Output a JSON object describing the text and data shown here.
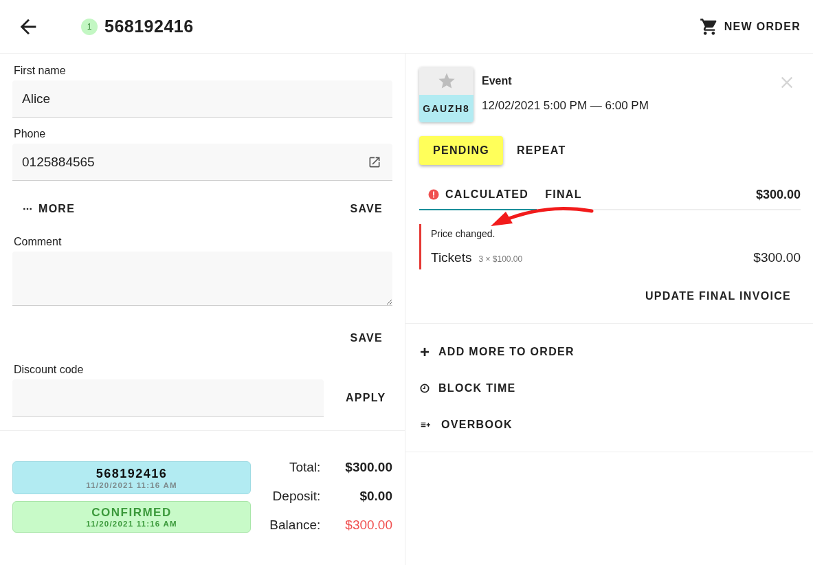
{
  "header": {
    "badge": "1",
    "order_number": "568192416",
    "new_order": "NEW ORDER"
  },
  "contact": {
    "first_name": {
      "label": "First name",
      "value": "Alice"
    },
    "phone": {
      "label": "Phone",
      "value": "0125884565"
    },
    "more": "MORE",
    "save": "SAVE"
  },
  "comment": {
    "label": "Comment",
    "save": "SAVE"
  },
  "discount": {
    "label": "Discount code",
    "apply": "APPLY"
  },
  "status_badges": [
    {
      "kind": "order",
      "title": "568192416",
      "time": "11/20/2021 11:16 AM"
    },
    {
      "kind": "confirmed",
      "title": "CONFIRMED",
      "time": "11/20/2021 11:16 AM"
    }
  ],
  "totals": [
    {
      "label": "Total:",
      "value": "$300.00",
      "highlighted": false
    },
    {
      "label": "Deposit:",
      "value": "$0.00",
      "highlighted": false
    },
    {
      "label": "Balance:",
      "value": "$300.00",
      "highlighted": true
    }
  ],
  "event": {
    "code": "GAUZH8",
    "title": "Event",
    "time": "12/02/2021 5:00 PM — 6:00 PM"
  },
  "status_buttons": [
    {
      "kind": "raised",
      "label": "PENDING"
    },
    {
      "kind": "text",
      "label": "REPEAT"
    }
  ],
  "invoice_tabs": [
    {
      "label": "CALCULATED",
      "selected": true,
      "warning": true
    },
    {
      "label": "FINAL",
      "selected": false,
      "warning": false
    }
  ],
  "invoice_total": "$300.00",
  "notice": "Price changed.",
  "line_items": [
    {
      "name": "Tickets",
      "detail": "3 × $100.00",
      "amount": "$300.00",
      "changed": true
    }
  ],
  "update_button": "UPDATE FINAL INVOICE",
  "actions": [
    {
      "kind": "add",
      "label": "ADD MORE TO ORDER"
    },
    {
      "kind": "block",
      "label": "BLOCK TIME"
    },
    {
      "kind": "overbook",
      "label": "OVERBOOK"
    }
  ]
}
